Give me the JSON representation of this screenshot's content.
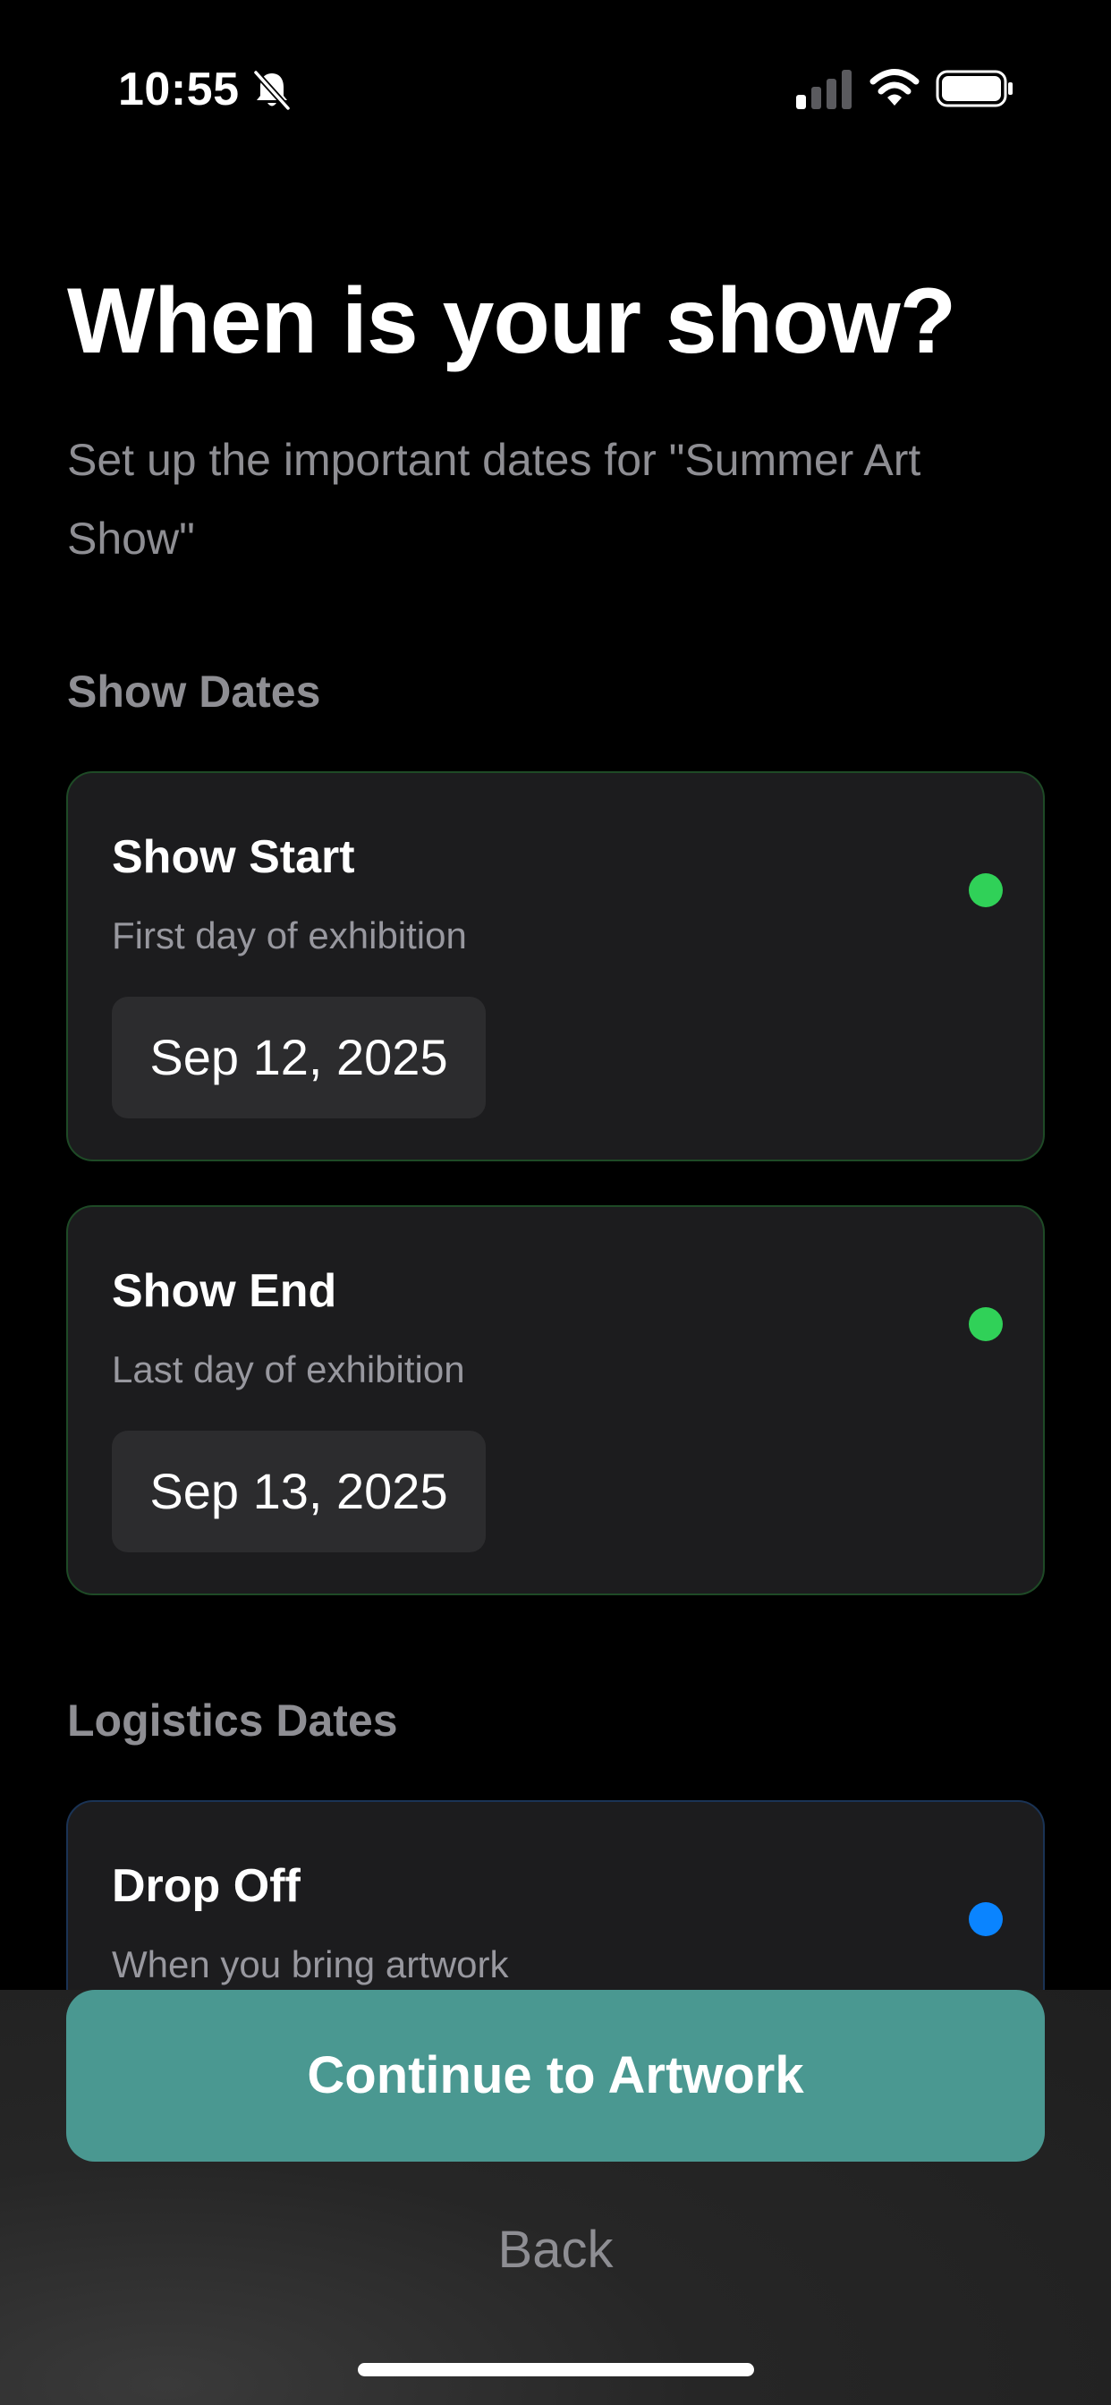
{
  "status_bar": {
    "time": "10:55",
    "icons": [
      "bell-slash-icon",
      "cellular-signal-icon",
      "wifi-icon",
      "battery-icon"
    ]
  },
  "header": {
    "title": "When is your show?",
    "subtitle": "Set up the important dates for \"Summer Art Show\""
  },
  "sections": {
    "show_dates_label": "Show Dates",
    "logistics_dates_label": "Logistics Dates"
  },
  "cards": {
    "show_start": {
      "title": "Show Start",
      "description": "First day of exhibition",
      "date": "Sep 12, 2025",
      "dot_color": "#30d158"
    },
    "show_end": {
      "title": "Show End",
      "description": "Last day of exhibition",
      "date": "Sep 13, 2025",
      "dot_color": "#30d158"
    },
    "drop_off": {
      "title": "Drop Off",
      "description": "When you bring artwork",
      "dot_color": "#0a84ff"
    }
  },
  "actions": {
    "continue_label": "Continue to Artwork",
    "back_label": "Back"
  },
  "colors": {
    "accent": "#4a9891",
    "background": "#000000",
    "card": "#1c1c1e",
    "status_green": "#30d158",
    "status_blue": "#0a84ff"
  }
}
